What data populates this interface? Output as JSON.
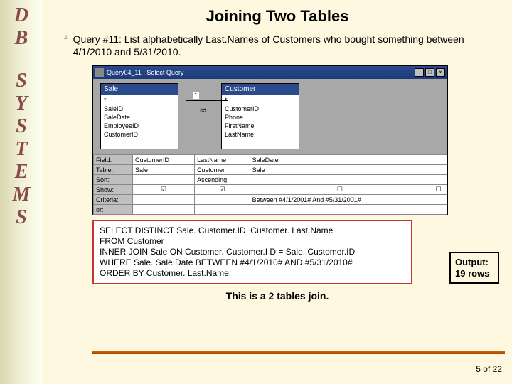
{
  "sidebar": {
    "letters": [
      "D",
      "B",
      "",
      "S",
      "Y",
      "S",
      "T",
      "E",
      "M",
      "S"
    ]
  },
  "title": "Joining Two Tables",
  "bullet": {
    "symbol": "²",
    "text": "Query #11: List alphabetically Last.Names of Customers who bought something between 4/1/2010 and 5/31/2010."
  },
  "qwin": {
    "title": "Query04_11 : Select Query",
    "btns": {
      "min": "_",
      "max": "□",
      "close": "×"
    },
    "join": {
      "label": "1",
      "inf": "∞"
    },
    "tables": {
      "sale": {
        "header": "Sale",
        "fields": [
          "*",
          "SaleID",
          "SaleDate",
          "EmployeeID",
          "CustomerID"
        ]
      },
      "cust": {
        "header": "Customer",
        "fields": [
          "*",
          "CustomerID",
          "Phone",
          "FirstName",
          "LastName"
        ]
      }
    },
    "grid": {
      "rows": {
        "field": {
          "lbl": "Field:",
          "c1": "CustomerID",
          "c2": "LastName",
          "c3": "SaleDate",
          "c4": ""
        },
        "table": {
          "lbl": "Table:",
          "c1": "Sale",
          "c2": "Customer",
          "c3": "Sale",
          "c4": ""
        },
        "sort": {
          "lbl": "Sort:",
          "c1": "",
          "c2": "Ascending",
          "c3": "",
          "c4": ""
        },
        "show": {
          "lbl": "Show:",
          "c1": "☑",
          "c2": "☑",
          "c3": "☐",
          "c4": "☐"
        },
        "criteria": {
          "lbl": "Criteria:",
          "c1": "",
          "c2": "",
          "c3": "Between #4/1/2001# And #5/31/2001#",
          "c4": ""
        },
        "or": {
          "lbl": "or:",
          "c1": "",
          "c2": "",
          "c3": "",
          "c4": ""
        }
      }
    }
  },
  "sql": {
    "l1": "SELECT DISTINCT Sale. Customer.ID, Customer. Last.Name",
    "l2": "FROM Customer",
    "l3": "INNER JOIN Sale ON Customer. Customer.I D = Sale. Customer.ID",
    "l4": "WHERE Sale. Sale.Date BETWEEN #4/1/2010# AND #5/31/2010#",
    "l5": "ORDER BY Customer. Last.Name;"
  },
  "output": {
    "label": "Output:",
    "value": "19 rows"
  },
  "caption": "This is a 2 tables join.",
  "footer": "5 of 22"
}
